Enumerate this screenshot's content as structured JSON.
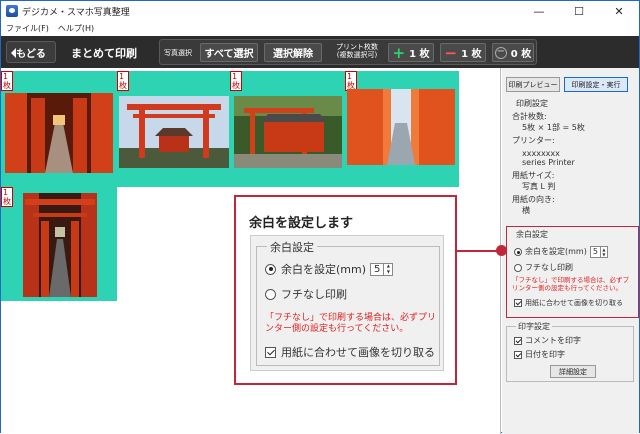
{
  "window": {
    "title": "デジカメ・スマホ写真整理"
  },
  "menu": [
    "ファイル(F)",
    "ヘルプ(H)"
  ],
  "toolbar": {
    "back": "もどる",
    "title": "まとめて印刷",
    "photo_select": "写真選択",
    "select_all": "すべて選択",
    "deselect": "選択解除",
    "print_count_label": "プリント枚数",
    "print_count_sub": "(複数選択可)",
    "plus_one": "1 枚",
    "minus_one": "1 枚",
    "zero": "0 枚"
  },
  "photos": {
    "count_label": "1枚"
  },
  "sidebar": {
    "preview_btn": "印刷プレビュー",
    "settings_btn": "印刷設定・実行",
    "print_settings": "印刷設定",
    "total_label": "合計枚数:",
    "total_value": "5枚 × 1部 = 5枚",
    "printer_label": "プリンター:",
    "printer_value_1": "xxxxxxxx",
    "printer_value_2": "series Printer",
    "paper_label": "用紙サイズ:",
    "paper_value": "写真 L 判",
    "orient_label": "用紙の向き:",
    "orient_value": "横",
    "margin_title": "余白設定",
    "margin_set": "余白を設定(mm)",
    "margin_value": "5",
    "borderless": "フチなし印刷",
    "note": "「フチなし」で印刷する場合は、必ずプリンター側の設定も行ってください。",
    "crop": "用紙に合わせて画像を切り取る",
    "print_set_title": "印字設定",
    "print_comment": "コメントを印字",
    "print_date": "日付を印字",
    "detail_btn": "詳細設定"
  },
  "callout": {
    "title": "余白を設定します",
    "group": "余白設定",
    "margin_set": "余白を設定(mm)",
    "margin_value": "5",
    "borderless": "フチなし印刷",
    "note": "「フチなし」で印刷する場合は、必ずプリンター側の設定も行ってください。",
    "crop": "用紙に合わせて画像を切り取る"
  },
  "colors": {
    "accent": "#c0283a",
    "photo_bg": "#2ed3b4",
    "toolbar": "#2c2c2c",
    "note_red": "#e02020"
  }
}
